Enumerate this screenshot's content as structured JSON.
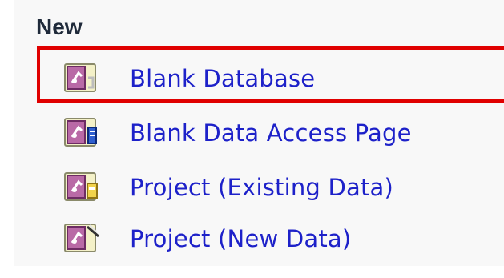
{
  "section": {
    "title": "New"
  },
  "items": [
    {
      "label": "Blank Database",
      "icon": "access-database-icon"
    },
    {
      "label": "Blank Data Access Page",
      "icon": "data-access-page-icon"
    },
    {
      "label": "Project (Existing Data)",
      "icon": "project-existing-data-icon"
    },
    {
      "label": "Project (New Data)",
      "icon": "project-new-data-icon"
    }
  ],
  "highlight": {
    "target": "Blank Database",
    "color": "#e00000"
  },
  "colors": {
    "link": "#1d21c9",
    "heading": "#1f2a3a",
    "pane_background": "#f8f8f8"
  }
}
